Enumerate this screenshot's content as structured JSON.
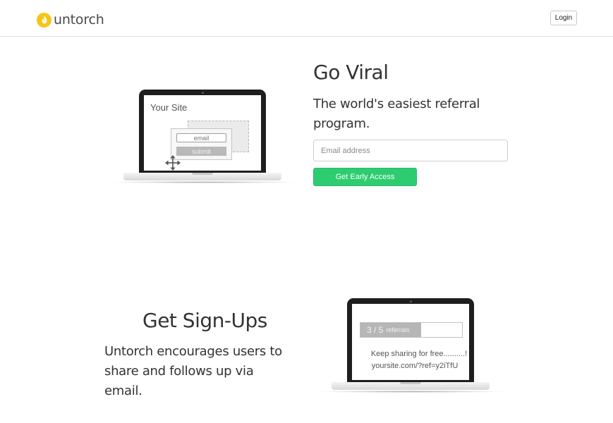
{
  "header": {
    "brand": "untorch",
    "login_label": "Login"
  },
  "hero": {
    "title": "Go Viral",
    "subtitle": "The world's easiest referral program.",
    "email_placeholder": "Email address",
    "cta_label": "Get Early Access",
    "mockup": {
      "site_label": "Your Site",
      "email_field": "email",
      "submit_button": "submit"
    }
  },
  "signups": {
    "title": "Get Sign-Ups",
    "text": "Untorch encourages users to share and follows up via email.",
    "mockup": {
      "referral_count": "3 / 5",
      "referral_word": "referrals",
      "referral_progress": 0.6,
      "share_text": "Keep sharing for free..........!",
      "share_link": "yoursite.com/?ref=y2iTfU"
    }
  },
  "colors": {
    "brand_yellow": "#f5c518",
    "cta_green": "#2ecc71"
  },
  "icons": {
    "logo": "flame-icon",
    "move": "move-arrows-icon"
  }
}
